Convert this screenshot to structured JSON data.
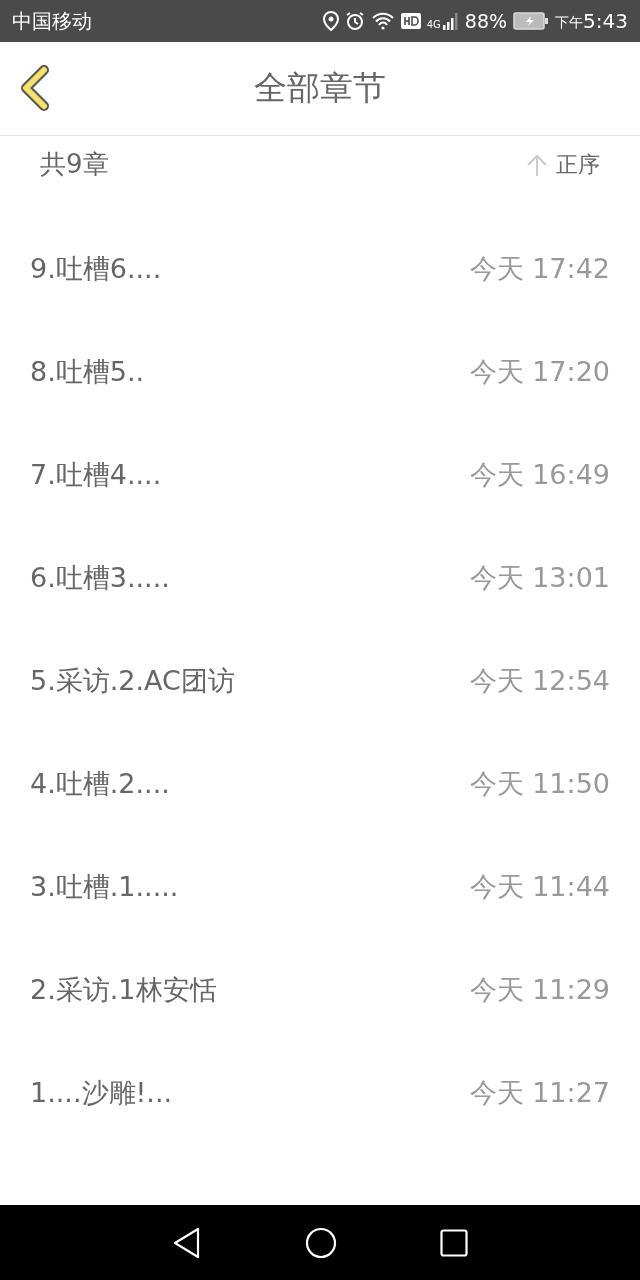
{
  "status_bar": {
    "carrier": "中国移动",
    "network": "4G",
    "battery": "88%",
    "time_period": "下午",
    "time": "5:43"
  },
  "header": {
    "title": "全部章节"
  },
  "summary": {
    "count": "共9章",
    "sort": "正序"
  },
  "chapters": [
    {
      "title": "9.吐槽6....",
      "time": "今天 17:42"
    },
    {
      "title": "8.吐槽5..",
      "time": "今天 17:20"
    },
    {
      "title": "7.吐槽4....",
      "time": "今天 16:49"
    },
    {
      "title": "6.吐槽3.....",
      "time": "今天 13:01"
    },
    {
      "title": "5.采访.2.AC团访",
      "time": "今天 12:54"
    },
    {
      "title": "4.吐槽.2....",
      "time": "今天 11:50"
    },
    {
      "title": "3.吐槽.1.....",
      "time": "今天 11:44"
    },
    {
      "title": "2.采访.1林安恬",
      "time": "今天 11:29"
    },
    {
      "title": "1....沙雕!...",
      "time": "今天 11:27"
    }
  ]
}
